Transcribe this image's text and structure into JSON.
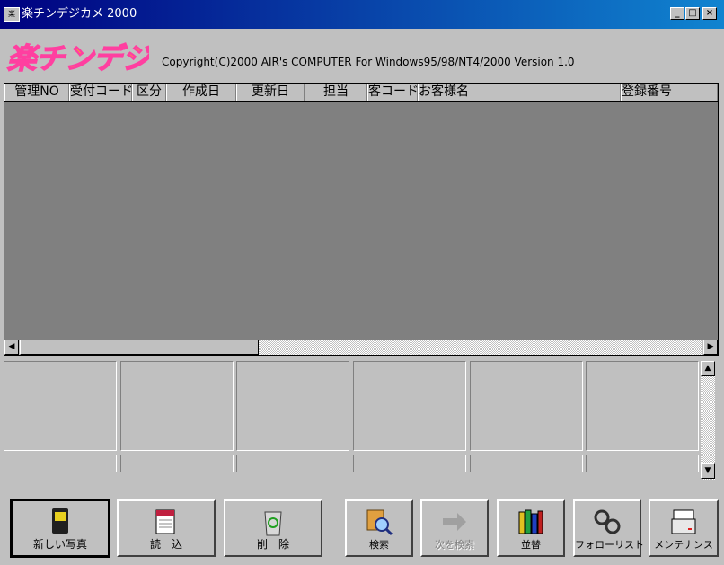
{
  "window": {
    "title": "楽チンデジカメ 2000",
    "icon_text": "楽"
  },
  "controls": {
    "minimize": "_",
    "maximize": "□",
    "close": "×"
  },
  "header": {
    "logo_text": "楽チンデジカメ",
    "copyright": "Copyright(C)2000 AIR's COMPUTER   For Windows95/98/NT4/2000   Version 1.0"
  },
  "grid": {
    "columns": [
      "管理NO",
      "受付コード",
      "区分",
      "作成日",
      "更新日",
      "担当",
      "客コード",
      "お客様名",
      "登録番号"
    ],
    "rows": []
  },
  "scroll": {
    "left": "◀",
    "right": "▶",
    "up": "▲",
    "down": "▼"
  },
  "toolbar": {
    "new_photo": "新しい写真",
    "load": "読　込",
    "delete": "削　除",
    "search": "検索",
    "search_next": "次を検索",
    "sort": "並替",
    "follow_list": "フォローリスト",
    "maintenance": "メンテナンス"
  },
  "colors": {
    "title_start": "#000080",
    "title_end": "#1084d0",
    "logo_pink": "#ff3fa0",
    "logo_yellow": "#ffcc00"
  }
}
